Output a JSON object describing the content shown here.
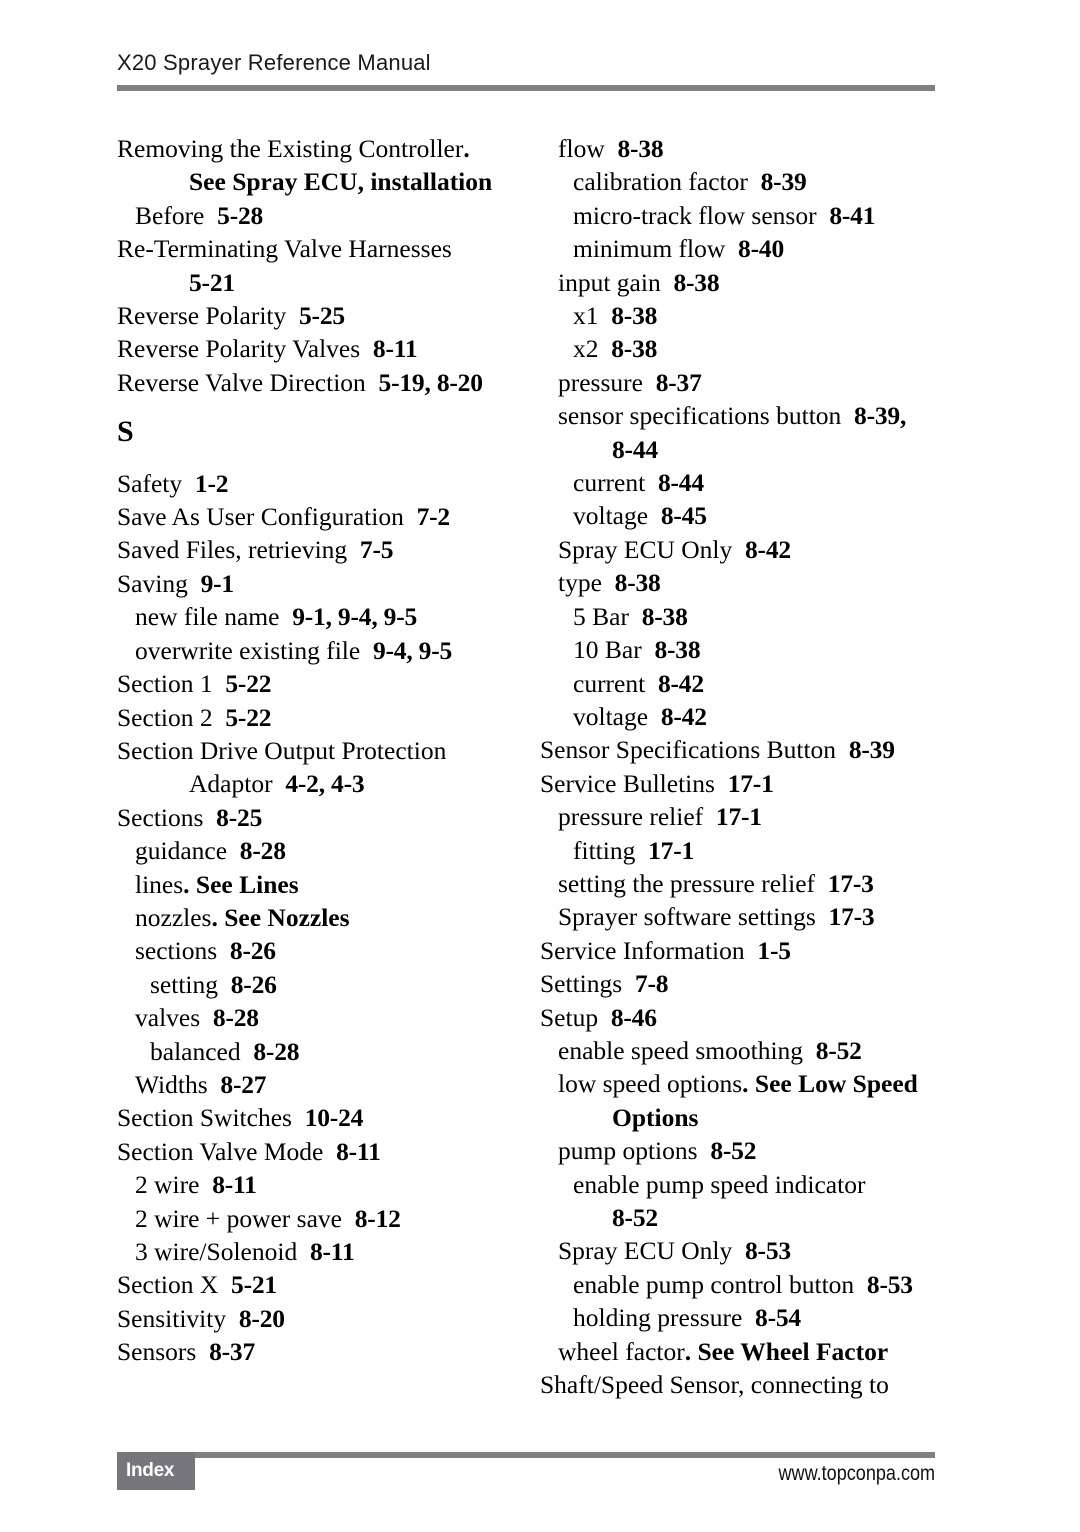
{
  "header": {
    "title": "X20 Sprayer Reference Manual"
  },
  "footer": {
    "badge_label": "Index",
    "url": "www.topconpa.com",
    "rule_color": "#808080",
    "badge_color": "#76767c"
  },
  "index": {
    "left_column": [
      {
        "text": "Removing the Existing Controller",
        "dot": ".",
        "level": 0
      },
      {
        "see": "See Spray ECU, installation",
        "level": "cont"
      },
      {
        "text": "Before",
        "page": "5-28",
        "level": 1
      },
      {
        "text": "Re-Terminating Valve Harnesses",
        "level": 0
      },
      {
        "page": "5-21",
        "level": "cont"
      },
      {
        "text": "Reverse Polarity",
        "page": "5-25",
        "level": 0
      },
      {
        "text": "Reverse Polarity Valves",
        "page": "8-11",
        "level": 0
      },
      {
        "text": "Reverse Valve Direction",
        "page": "5-19, 8-20",
        "level": 0
      },
      {
        "letter": "S"
      },
      {
        "text": "Safety",
        "page": "1-2",
        "level": 0
      },
      {
        "text": "Save As User Configuration",
        "page": "7-2",
        "level": 0
      },
      {
        "text": "Saved Files, retrieving",
        "page": "7-5",
        "level": 0
      },
      {
        "text": "Saving",
        "page": "9-1",
        "level": 0
      },
      {
        "text": "new file name",
        "page": "9-1, 9-4, 9-5",
        "level": 1
      },
      {
        "text": "overwrite existing file",
        "page": "9-4, 9-5",
        "level": 1
      },
      {
        "text": "Section 1",
        "page": "5-22",
        "level": 0
      },
      {
        "text": "Section 2",
        "page": "5-22",
        "level": 0
      },
      {
        "text": "Section Drive Output Protection",
        "level": 0
      },
      {
        "text": "Adaptor",
        "page": "4-2, 4-3",
        "level": "cont"
      },
      {
        "text": "Sections",
        "page": "8-25",
        "level": 0
      },
      {
        "text": "guidance",
        "page": "8-28",
        "level": 1
      },
      {
        "text": "lines",
        "dot": ".",
        "see": "See Lines",
        "level": 1
      },
      {
        "text": "nozzles",
        "dot": ".",
        "see": "See Nozzles",
        "level": 1
      },
      {
        "text": "sections",
        "page": "8-26",
        "level": 1
      },
      {
        "text": "setting",
        "page": "8-26",
        "level": 2
      },
      {
        "text": "valves",
        "page": "8-28",
        "level": 1
      },
      {
        "text": "balanced",
        "page": "8-28",
        "level": 2
      },
      {
        "text": "Widths",
        "page": "8-27",
        "level": 1
      },
      {
        "text": "Section Switches",
        "page": "10-24",
        "level": 0
      },
      {
        "text": "Section Valve Mode",
        "page": "8-11",
        "level": 0
      },
      {
        "text": "2 wire",
        "page": "8-11",
        "level": 1
      },
      {
        "text": "2 wire + power save",
        "page": "8-12",
        "level": 1
      },
      {
        "text": "3 wire/Solenoid",
        "page": "8-11",
        "level": 1
      },
      {
        "text": "Section X",
        "page": "5-21",
        "level": 0
      },
      {
        "text": "Sensitivity",
        "page": "8-20",
        "level": 0
      },
      {
        "text": "Sensors",
        "page": "8-37",
        "level": 0
      }
    ],
    "right_column": [
      {
        "text": "flow",
        "page": "8-38",
        "level": 1
      },
      {
        "text": "calibration factor",
        "page": "8-39",
        "level": 2
      },
      {
        "text": "micro-track flow sensor",
        "page": "8-41",
        "level": 2
      },
      {
        "text": "minimum flow",
        "page": "8-40",
        "level": 2
      },
      {
        "text": "input gain",
        "page": "8-38",
        "level": 1
      },
      {
        "text": "x1",
        "page": "8-38",
        "level": 2
      },
      {
        "text": "x2",
        "page": "8-38",
        "level": 2
      },
      {
        "text": "pressure",
        "page": "8-37",
        "level": 1
      },
      {
        "text": "sensor specifications button",
        "page": "8-39,",
        "level": 1
      },
      {
        "page": "8-44",
        "level": "cont"
      },
      {
        "text": "current",
        "page": "8-44",
        "level": 2
      },
      {
        "text": "voltage",
        "page": "8-45",
        "level": 2
      },
      {
        "text": "Spray ECU Only",
        "page": "8-42",
        "level": 1
      },
      {
        "text": "type",
        "page": "8-38",
        "level": 1
      },
      {
        "text": "5 Bar",
        "page": "8-38",
        "level": 2
      },
      {
        "text": "10 Bar",
        "page": "8-38",
        "level": 2
      },
      {
        "text": "current",
        "page": "8-42",
        "level": 2
      },
      {
        "text": "voltage",
        "page": "8-42",
        "level": 2
      },
      {
        "text": "Sensor Specifications Button",
        "page": "8-39",
        "level": 0
      },
      {
        "text": "Service Bulletins",
        "page": "17-1",
        "level": 0
      },
      {
        "text": "pressure relief",
        "page": "17-1",
        "level": 1
      },
      {
        "text": "fitting",
        "page": "17-1",
        "level": 2
      },
      {
        "text": "setting the pressure relief",
        "page": "17-3",
        "level": 1
      },
      {
        "text": "Sprayer software settings",
        "page": "17-3",
        "level": 1
      },
      {
        "text": "Service Information",
        "page": "1-5",
        "level": 0
      },
      {
        "text": "Settings",
        "page": "7-8",
        "level": 0
      },
      {
        "text": "Setup",
        "page": "8-46",
        "level": 0
      },
      {
        "text": "enable speed smoothing",
        "page": "8-52",
        "level": 1
      },
      {
        "text": "low speed options",
        "dot": ".",
        "see": "See Low Speed",
        "level": 1
      },
      {
        "see": "Options",
        "level": "cont"
      },
      {
        "text": "pump options",
        "page": "8-52",
        "level": 1
      },
      {
        "text": "enable pump speed indicator",
        "level": 2
      },
      {
        "page": "8-52",
        "level": "cont"
      },
      {
        "text": "Spray ECU Only",
        "page": "8-53",
        "level": 1
      },
      {
        "text": "enable pump control button",
        "page": "8-53",
        "level": 2
      },
      {
        "text": "holding pressure",
        "page": "8-54",
        "level": 2
      },
      {
        "text": "wheel factor",
        "dot": ".",
        "see": "See Wheel Factor",
        "level": 1
      },
      {
        "text": "Shaft/Speed Sensor, connecting to",
        "level": 0
      }
    ]
  }
}
